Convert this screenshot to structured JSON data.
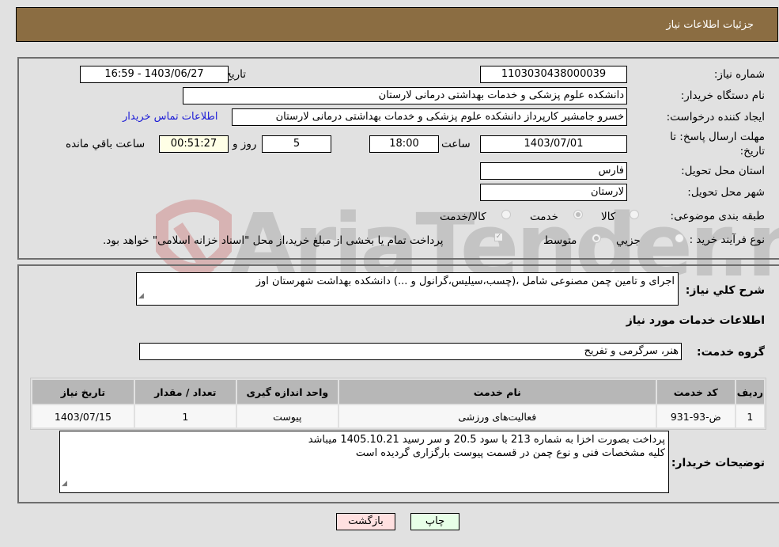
{
  "header": {
    "title": "جزئیات اطلاعات نیاز"
  },
  "form": {
    "need_number": {
      "label": "شماره نیاز:",
      "value": "1103030438000039"
    },
    "announce_datetime": {
      "label": "تاریخ و ساعت اعلان عمومی:",
      "value": "1403/06/27 - 16:59"
    },
    "buyer_org": {
      "label": "نام دستگاه خریدار:",
      "value": "دانشکده علوم پزشکی و خدمات بهداشتی  درمانی لارستان"
    },
    "requester": {
      "label": "ایجاد کننده درخواست:",
      "value": "خسرو جامشیر کارپرداز دانشکده علوم پزشکی و خدمات بهداشتی  درمانی لارستان"
    },
    "buyer_contact_link": "اطلاعات تماس خریدار",
    "deadline": {
      "label": "مهلت ارسال پاسخ: تا تاریخ:",
      "date": "1403/07/01",
      "time_label": "ساعت",
      "time": "18:00",
      "days": "5",
      "days_label": "روز و",
      "remaining": "00:51:27",
      "remaining_label": "ساعت باقي مانده"
    },
    "province": {
      "label": "استان محل تحویل:",
      "value": "فارس"
    },
    "city": {
      "label": "شهر محل تحویل:",
      "value": "لارستان"
    },
    "category": {
      "label": "طبقه بندی موضوعی:",
      "options": [
        {
          "label": "کالا",
          "checked": false
        },
        {
          "label": "خدمت",
          "checked": true
        },
        {
          "label": "کالا/خدمت",
          "checked": false
        }
      ]
    },
    "purchase_type": {
      "label": "نوع فرآیند خرید :",
      "options": [
        {
          "label": "جزيي",
          "checked": false
        },
        {
          "label": "متوسط",
          "checked": true
        }
      ],
      "treasury_note": "پرداخت تمام یا بخشی از مبلغ خرید،از محل \"اسناد خزانه اسلامی\" خواهد بود.",
      "treasury_checked": true
    }
  },
  "details": {
    "general_desc_label": "شرح كلي نياز:",
    "general_desc": "اجرای و تامین  چمن مصنوعی شامل ،(چسب،سیلیس،گرانول و ...) دانشکده بهداشت شهرستان اوز",
    "services_heading": "اطلاعات خدمات مورد نیاز",
    "service_group_label": "گروه خدمت:",
    "service_group": "هنر، سرگرمی و تفریح",
    "table": {
      "headers": [
        "رديف",
        "کد خدمت",
        "نام خدمت",
        "واحد اندازه گیری",
        "تعداد / مقدار",
        "تاریخ نیاز"
      ],
      "rows": [
        [
          "1",
          "ض-93-931",
          "فعالیت‌های ورزشی",
          "پیوست",
          "1",
          "1403/07/15"
        ]
      ]
    },
    "buyer_notes_label": "توضیحات خریدار:",
    "buyer_notes_line1": "پرداخت بصورت اخزا به شماره 213 با سود 20.5 و سر رسید 1405.10.21 میباشد",
    "buyer_notes_line2": "کلیه مشخصات فنی و نوع چمن در قسمت پیوست بارگزاری گردیده است"
  },
  "buttons": {
    "print": "چاپ",
    "back": "بازگشت"
  },
  "watermark": {
    "text": "AriaTender.neT"
  }
}
